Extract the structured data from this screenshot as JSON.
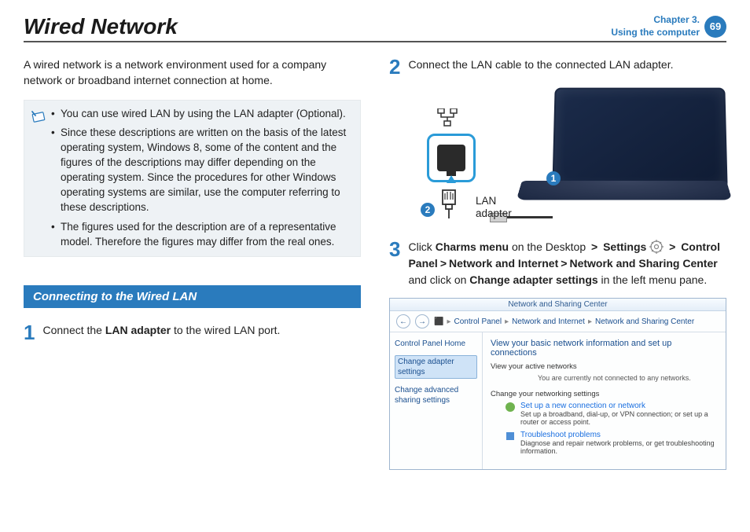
{
  "header": {
    "title": "Wired Network",
    "chapter_line1": "Chapter 3.",
    "chapter_line2": "Using the computer",
    "page_number": "69"
  },
  "intro": "A wired network is a network environment used for a company network or broadband internet connection at home.",
  "notes": [
    "You can use wired LAN by using the LAN adapter (Optional).",
    "Since these descriptions are written on the basis of the latest operating system, Windows 8, some of the content and the figures of the descriptions may differ depending on the operating system. Since the procedures for other Windows operating systems are similar, use the computer referring to these descriptions.",
    "The figures used for the description are of a representative model. Therefore the figures may differ from the real ones."
  ],
  "section_head": "Connecting to the Wired LAN",
  "steps": {
    "s1": {
      "num": "1",
      "pre": "Connect the ",
      "bold1": "LAN adapter",
      "post": " to the wired LAN port."
    },
    "s2": {
      "num": "2",
      "text": "Connect the LAN cable to the connected LAN adapter."
    },
    "s3": {
      "num": "3",
      "pre": "Click ",
      "b1": "Charms menu",
      "mid1": " on the Desktop ",
      "b2": "Settings",
      "b3": "Control Panel",
      "b4": "Network and Internet",
      "b5": "Network and Sharing Center",
      "mid2": " and click on ",
      "b6": "Change adapter settings",
      "post": " in the left menu pane."
    }
  },
  "gt": ">",
  "figure": {
    "callout1": "1",
    "callout2": "2",
    "lan_label_l1": "LAN",
    "lan_label_l2": "adapter"
  },
  "ncp": {
    "title": "Network and Sharing Center",
    "crumb": {
      "c1": "Control Panel",
      "c2": "Network and Internet",
      "c3": "Network and Sharing Center"
    },
    "side": {
      "home": "Control Panel Home",
      "change_adapter": "Change adapter settings",
      "change_adv": "Change advanced sharing settings"
    },
    "main": {
      "h1": "View your basic network information and set up connections",
      "active_net": "View your active networks",
      "not_connected": "You are currently not connected to any networks.",
      "change_net": "Change your networking settings",
      "item1_t": "Set up a new connection or network",
      "item1_d": "Set up a broadband, dial-up, or VPN connection; or set up a router or access point.",
      "item2_t": "Troubleshoot problems",
      "item2_d": "Diagnose and repair network problems, or get troubleshooting information."
    }
  }
}
